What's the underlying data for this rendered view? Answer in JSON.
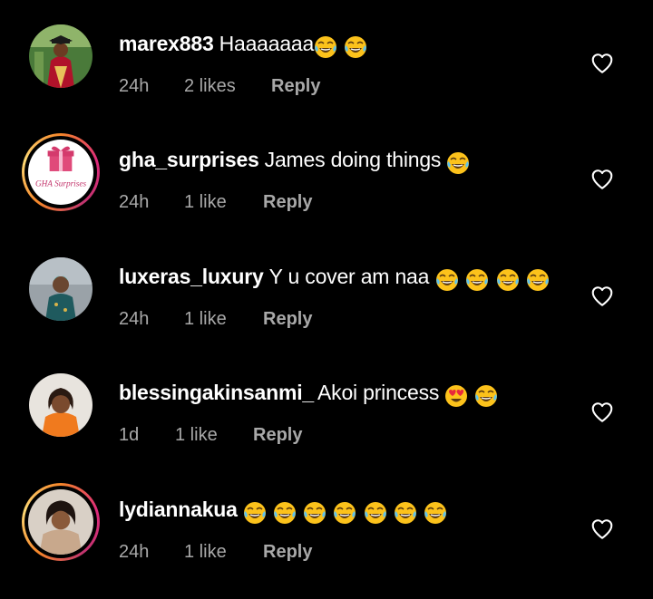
{
  "comments": [
    {
      "username": "marex883",
      "text": "Haaaaaaa",
      "emojis": [
        "laughing",
        "laughing"
      ],
      "time": "24h",
      "likes": "2 likes",
      "reply": "Reply",
      "story_ring": false
    },
    {
      "username": "gha_surprises",
      "text": "James doing things",
      "emojis": [
        "laughing"
      ],
      "time": "24h",
      "likes": "1 like",
      "reply": "Reply",
      "story_ring": true,
      "avatar_label": "GHA Surprises"
    },
    {
      "username": "luxeras_luxury",
      "text": "Y u cover am naa",
      "emojis": [
        "laughing",
        "laughing",
        "laughing",
        "laughing"
      ],
      "time": "24h",
      "likes": "1 like",
      "reply": "Reply",
      "story_ring": false
    },
    {
      "username": "blessingakinsanmi_",
      "text": "Akoi princess",
      "emojis": [
        "heart-eyes",
        "laughing"
      ],
      "time": "1d",
      "likes": "1 like",
      "reply": "Reply",
      "story_ring": false
    },
    {
      "username": "lydiannakua",
      "text": "",
      "emojis": [
        "laughing",
        "laughing",
        "laughing",
        "laughing",
        "laughing",
        "laughing",
        "laughing"
      ],
      "time": "24h",
      "likes": "1 like",
      "reply": "Reply",
      "story_ring": true
    }
  ],
  "icons": {
    "like": "heart-outline-icon"
  },
  "colors": {
    "background": "#000000",
    "primary_text": "#ffffff",
    "secondary_text": "#a8a8a8",
    "ring_gradient": [
      "#f58529",
      "#dd2a7b",
      "#feda75"
    ]
  }
}
